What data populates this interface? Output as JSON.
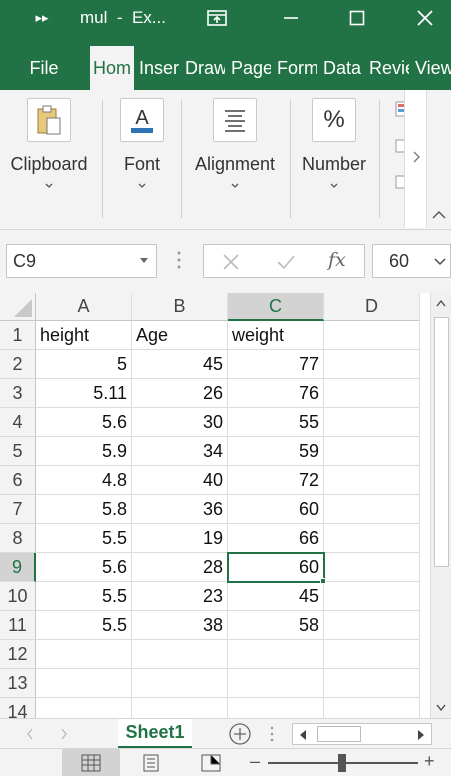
{
  "title_bar": {
    "title": "mul  -  Ex...",
    "quick_access_icon": "chevrons-right-icon",
    "display_options_icon": "ribbon-display-icon",
    "minimize_icon": "minimize-icon",
    "maximize_icon": "maximize-icon",
    "close_icon": "close-icon"
  },
  "ribbon_tabs": [
    {
      "label": "File"
    },
    {
      "label": "Hom"
    },
    {
      "label": "Inser"
    },
    {
      "label": "Draw"
    },
    {
      "label": "Page"
    },
    {
      "label": "Form"
    },
    {
      "label": "Data"
    },
    {
      "label": "Revie"
    },
    {
      "label": "View"
    }
  ],
  "ribbon_groups": [
    {
      "label": "Clipboard",
      "icon": "clipboard-icon"
    },
    {
      "label": "Font",
      "icon": "font-color-icon"
    },
    {
      "label": "Alignment",
      "icon": "align-icon"
    },
    {
      "label": "Number",
      "icon": "percent-icon"
    }
  ],
  "formula_bar": {
    "name_box": "C9",
    "formula_value": "60",
    "fx_label": "fx"
  },
  "sheet": {
    "columns": [
      "A",
      "B",
      "C",
      "D"
    ],
    "selected_column": "C",
    "selected_row": "9",
    "rows": [
      {
        "num": "1",
        "cells": [
          "height",
          "Age",
          "weight",
          ""
        ]
      },
      {
        "num": "2",
        "cells": [
          "5",
          "45",
          "77",
          ""
        ]
      },
      {
        "num": "3",
        "cells": [
          "5.11",
          "26",
          "76",
          ""
        ]
      },
      {
        "num": "4",
        "cells": [
          "5.6",
          "30",
          "55",
          ""
        ]
      },
      {
        "num": "5",
        "cells": [
          "5.9",
          "34",
          "59",
          ""
        ]
      },
      {
        "num": "6",
        "cells": [
          "4.8",
          "40",
          "72",
          ""
        ]
      },
      {
        "num": "7",
        "cells": [
          "5.8",
          "36",
          "60",
          ""
        ]
      },
      {
        "num": "8",
        "cells": [
          "5.5",
          "19",
          "66",
          ""
        ]
      },
      {
        "num": "9",
        "cells": [
          "5.6",
          "28",
          "60",
          ""
        ]
      },
      {
        "num": "10",
        "cells": [
          "5.5",
          "23",
          "45",
          ""
        ]
      },
      {
        "num": "11",
        "cells": [
          "5.5",
          "38",
          "58",
          ""
        ]
      },
      {
        "num": "12",
        "cells": [
          "",
          "",
          "",
          ""
        ]
      },
      {
        "num": "13",
        "cells": [
          "",
          "",
          "",
          ""
        ]
      },
      {
        "num": "14",
        "cells": [
          "",
          "",
          "",
          ""
        ]
      }
    ]
  },
  "sheet_tabs": [
    {
      "label": "Sheet1"
    }
  ],
  "colors": {
    "accent": "#217346",
    "ribbon_bg": "#f3f3f3",
    "header_selected": "#d3d3d3"
  }
}
